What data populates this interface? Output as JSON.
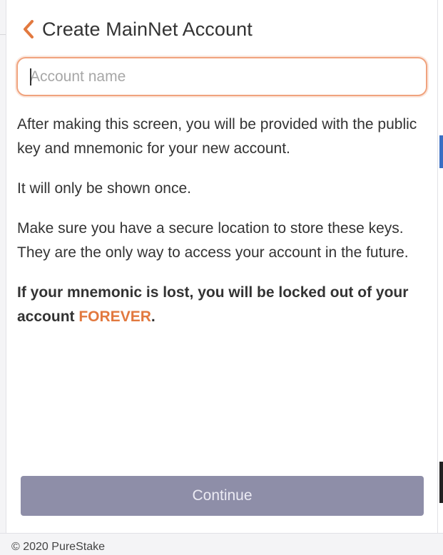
{
  "header": {
    "title": "Create MainNet Account",
    "back_icon": "chevron-left-icon"
  },
  "form": {
    "account_name_placeholder": "Account name",
    "account_name_value": ""
  },
  "content": {
    "paragraph_1": "After making this screen, you will be provided with the public key and mnemonic for your new account.",
    "paragraph_2": "It will only be shown once.",
    "paragraph_3": "Make sure you have a secure location to store these keys. They are the only way to access your account in the future.",
    "warning_prefix": "If your mnemonic is lost, you will be locked out of your account ",
    "warning_emphasis": "FOREVER",
    "warning_suffix": "."
  },
  "actions": {
    "continue_label": "Continue"
  },
  "footer": {
    "copyright": "© 2020 PureStake"
  },
  "colors": {
    "accent": "#e2793f",
    "input_border": "#f0a37e",
    "button_disabled": "#8e8ea8",
    "text": "#333333"
  }
}
